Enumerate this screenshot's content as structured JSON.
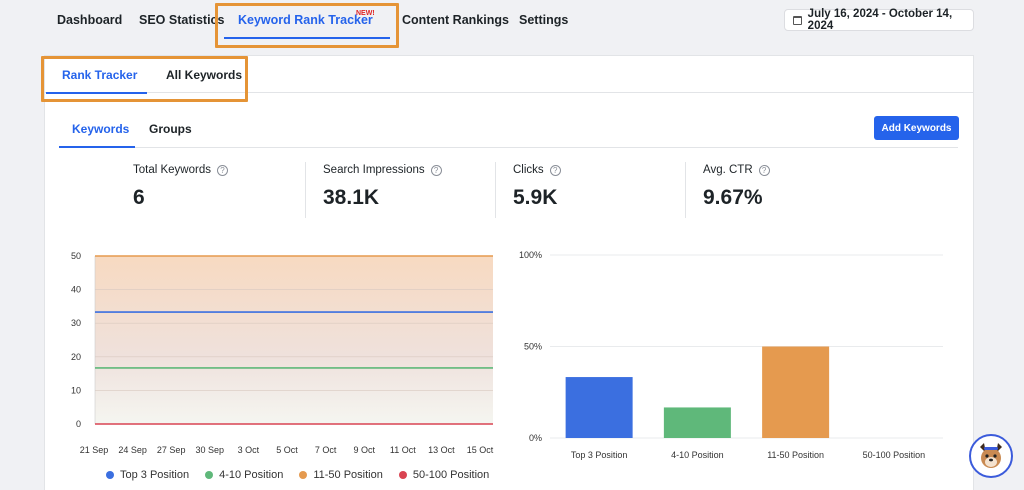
{
  "nav": {
    "items": [
      {
        "label": "Dashboard"
      },
      {
        "label": "SEO Statistics"
      },
      {
        "label": "Keyword Rank Tracker",
        "badge": "NEW!"
      },
      {
        "label": "Content Rankings"
      },
      {
        "label": "Settings"
      }
    ],
    "date_range": "July 16, 2024 - October 14, 2024"
  },
  "subtabs": [
    {
      "label": "Rank Tracker"
    },
    {
      "label": "All Keywords"
    }
  ],
  "kwtabs": [
    {
      "label": "Keywords"
    },
    {
      "label": "Groups"
    }
  ],
  "add_button": "Add Keywords",
  "stats": [
    {
      "label": "Total Keywords",
      "value": "6"
    },
    {
      "label": "Search Impressions",
      "value": "38.1K"
    },
    {
      "label": "Clicks",
      "value": "5.9K"
    },
    {
      "label": "Avg. CTR",
      "value": "9.67%"
    }
  ],
  "colors": {
    "accent": "#2563eb",
    "top3": "#3b6fe0",
    "pos4_10": "#5fb87a",
    "pos11_50": "#e59a4f",
    "pos50_100": "#d94452"
  },
  "chart_data": [
    {
      "type": "area",
      "x": [
        "21 Sep",
        "24 Sep",
        "27 Sep",
        "30 Sep",
        "3 Oct",
        "5 Oct",
        "7 Oct",
        "9 Oct",
        "11 Oct",
        "13 Oct",
        "15 Oct"
      ],
      "yticks": [
        0,
        10,
        20,
        30,
        40,
        50
      ],
      "ylim": [
        0,
        50
      ],
      "series": [
        {
          "name": "Top 3 Position",
          "value": 33.3,
          "color": "#3b6fe0"
        },
        {
          "name": "4-10 Position",
          "value": 16.7,
          "color": "#5fb87a"
        },
        {
          "name": "11-50 Position",
          "value": 50,
          "color": "#e59a4f"
        },
        {
          "name": "50-100 Position",
          "value": 0,
          "color": "#d94452"
        }
      ],
      "legend": "bottom"
    },
    {
      "type": "bar",
      "categories": [
        "Top 3 Position",
        "4-10 Position",
        "11-50 Position",
        "50-100 Position"
      ],
      "values": [
        33.3,
        16.7,
        50,
        0
      ],
      "colors": [
        "#3b6fe0",
        "#5fb87a",
        "#e59a4f",
        "#d94452"
      ],
      "yticks": [
        "0%",
        "50%",
        "100%"
      ],
      "ylim": [
        0,
        100
      ]
    }
  ]
}
